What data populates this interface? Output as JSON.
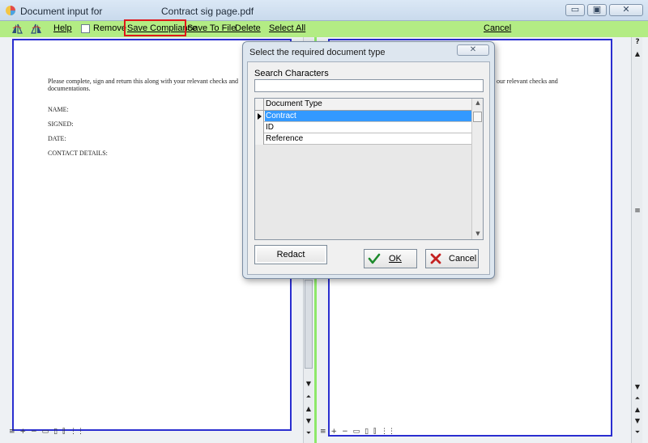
{
  "window": {
    "title": "Document input for",
    "file_name": "Contract sig page.pdf",
    "minimize_glyph": "▭",
    "maximize_glyph": "▣",
    "close_glyph": "✕"
  },
  "toolbar": {
    "help": "Help",
    "remove": "Remove",
    "save_compliance": "Save Compliance",
    "save_to_file": "Save To File",
    "delete": "Delete",
    "select_all": "Select All",
    "cancel": "Cancel",
    "help_glyph": "?"
  },
  "document_left": {
    "para_line1": "Please complete, sign and return this along with your relevant checks and",
    "para_line2": "documentations.",
    "name": "NAME:",
    "signed": "SIGNED:",
    "date": "DATE:",
    "contact": "CONTACT DETAILS:"
  },
  "document_right": {
    "para_line1": "our relevant checks and"
  },
  "dialog": {
    "title": "Select the required document type",
    "close_glyph": "✕",
    "search_label": "Search Characters",
    "search_value": "",
    "column_header": "Document Type",
    "rows": [
      "Contract",
      "ID",
      "Reference"
    ],
    "selected_row": 0,
    "redact": "Redact",
    "ok": "OK",
    "cancel": "Cancel"
  },
  "colors": {
    "toolbar_bg": "#b3ec84",
    "page_border": "#2a2ed0",
    "highlight": "#e0171a",
    "selection": "#3399ff"
  },
  "icons": [
    "app-icon",
    "mirror-icon",
    "mirror-alt-icon",
    "check-icon",
    "x-icon"
  ]
}
